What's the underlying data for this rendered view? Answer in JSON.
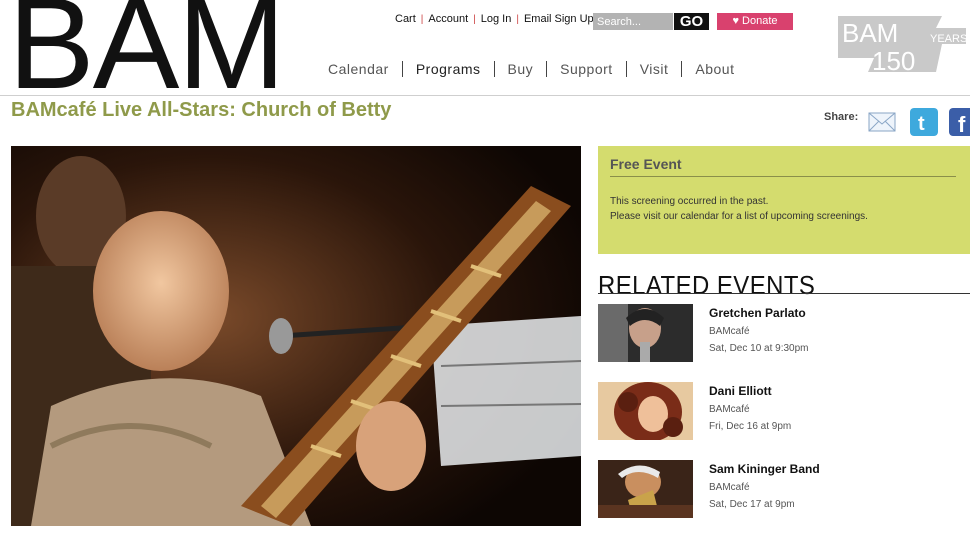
{
  "logo": {
    "text": "BAM"
  },
  "utility": {
    "cart": "Cart",
    "account": "Account",
    "login": "Log In",
    "email_signup": "Email Sign Up",
    "separator": "|",
    "search_placeholder": "Search...",
    "go": "GO",
    "donate": "♥ Donate"
  },
  "badge": {
    "line1": "BAM",
    "line2": "150",
    "line3": "YEARS"
  },
  "nav": [
    "Calendar",
    "Programs",
    "Buy",
    "Support",
    "Visit",
    "About"
  ],
  "nav_active": "Programs",
  "page": {
    "title": "BAMcafé Live All-Stars: Church of Betty"
  },
  "share": {
    "label": "Share:"
  },
  "free_event": {
    "title": "Free Event",
    "line1": "This screening occurred in the past.",
    "line2": "Please visit our calendar for a list of upcoming screenings."
  },
  "related": {
    "title": "RELATED EVENTS",
    "events": [
      {
        "name": "Gretchen Parlato",
        "venue": "BAMcafé",
        "date": "Sat, Dec 10 at 9:30pm"
      },
      {
        "name": "Dani Elliott",
        "venue": "BAMcafé",
        "date": "Fri, Dec 16 at 9pm"
      },
      {
        "name": "Sam Kininger Band",
        "venue": "BAMcafé",
        "date": "Sat, Dec 17 at 9pm"
      }
    ]
  },
  "colors": {
    "accent_olive": "#8f9a4a",
    "free_box": "#d4dc6e",
    "donate": "#d9416e"
  }
}
